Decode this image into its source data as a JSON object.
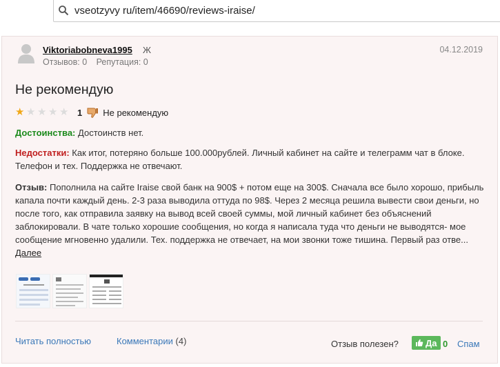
{
  "browser": {
    "url": "vseotzyvy ru/item/46690/reviews-iraise/"
  },
  "review": {
    "username": "Viktoriabobneva1995",
    "gender": "Ж",
    "reviews_label": "Отзывов: 0",
    "reputation_label": "Репутация: 0",
    "date": "04.12.2019",
    "title": "Не рекомендую",
    "rating": 1,
    "rating_value": "1",
    "rating_text": "Не рекомендую",
    "pros_label": "Достоинства:",
    "pros_text": "Достоинств нет.",
    "cons_label": "Недостатки:",
    "cons_text": "Как итог, потеряно больше 100.000рублей. Личный кабинет на сайте и телеграмм чат в блоке. Телефон и тех. Поддержка не отвечают.",
    "review_label": "Отзыв:",
    "review_text": "Пополнила на сайте Iraise свой банк на 900$ + потом еще на 300$. Сначала все было хорошо, прибыль капала почти каждый день. 2-3 раза выводила оттуда по 98$. Через 2 месяца решила вывести свои деньги, но после того, как отправила заявку на вывод всей своей суммы, мой личный кабинет без объяснений заблокировали. В чате только хорошие сообщения, но когда я написала туда что деньги не выводятся- мое сообщение мгновенно удалили. Тех. поддержка не отвечает, на мои звонки тоже тишина. Первый раз отве...",
    "more_link": "Далее"
  },
  "footer": {
    "read_full": "Читать полностью",
    "comments": "Комментарии",
    "comments_count": "(4)",
    "useful_label": "Отзыв полезен?",
    "yes_label": "Да",
    "yes_count": "0",
    "spam": "Спам"
  },
  "colors": {
    "pros": "#1b8a1b",
    "cons": "#c02020",
    "link": "#3a78b8",
    "yes_button": "#5cb85c",
    "star_on": "#f0a818"
  }
}
